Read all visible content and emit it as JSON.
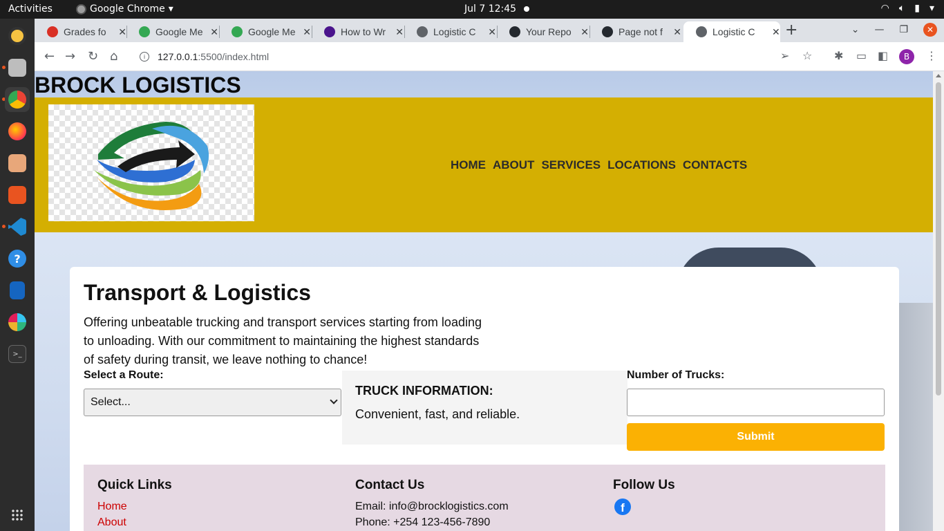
{
  "system": {
    "activities": "Activities",
    "app_name": "Google Chrome",
    "clock": "Jul 7  12:45"
  },
  "browser": {
    "tabs": [
      {
        "title": "Grades fo",
        "color": "#d93025"
      },
      {
        "title": "Google Me",
        "color": "#34a853"
      },
      {
        "title": "Google Me",
        "color": "#34a853"
      },
      {
        "title": "How to Wr",
        "color": "#4a148c"
      },
      {
        "title": "Logistic C",
        "color": "#5f6368"
      },
      {
        "title": "Your Repo",
        "color": "#24292f"
      },
      {
        "title": "Page not f",
        "color": "#24292f"
      },
      {
        "title": "Logistic C",
        "color": "#5f6368",
        "active": true
      }
    ],
    "url_host": "127.0.0.1",
    "url_path": ":5500/index.html",
    "profile_initial": "B"
  },
  "page": {
    "site_title": "BROCK LOGISTICS",
    "nav": [
      "HOME",
      "ABOUT",
      "SERVICES",
      "LOCATIONS",
      "CONTACTS"
    ],
    "hero": {
      "heading": "Transport & Logistics",
      "lead": "Offering unbeatable trucking and transport services starting from loading to unloading. With our commitment to maintaining the highest standards of safety during transit, we leave nothing to chance!"
    },
    "form": {
      "route_label": "Select a Route:",
      "route_selected": "Select...",
      "trucks_label": "Number of Trucks:",
      "trucks_value": "",
      "submit_label": "Submit"
    },
    "truck_info": {
      "title": "TRUCK INFORMATION:",
      "text": "Convenient, fast, and reliable."
    },
    "footer": {
      "quick_links_title": "Quick Links",
      "quick_links": [
        "Home",
        "About"
      ],
      "contact_title": "Contact Us",
      "email": "Email: info@brocklogistics.com",
      "phone": "Phone: +254 123-456-7890",
      "follow_title": "Follow Us",
      "social_icons": [
        "facebook-icon"
      ]
    }
  },
  "colors": {
    "header_bg": "#d4af02",
    "submit_bg": "#fbb103",
    "footer_bg": "#e6d9e3",
    "link": "#cc0000"
  }
}
